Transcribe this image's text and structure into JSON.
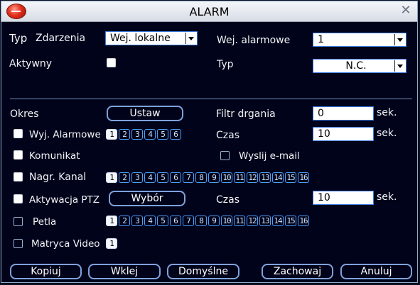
{
  "window": {
    "title": "ALARM"
  },
  "row_typ": {
    "label_typ": "Typ",
    "label_zdarzenia": "Zdarzenia",
    "value": "Wej. lokalne"
  },
  "row_wej": {
    "label": "Wej. alarmowe",
    "value": "1"
  },
  "row_aktywny": {
    "label": "Aktywny",
    "checked": false
  },
  "row_typ2": {
    "label": "Typ",
    "value": "N.C."
  },
  "okres": {
    "label": "Okres",
    "button": "Ustaw"
  },
  "filtr": {
    "label": "Filtr drgania",
    "value": "0",
    "unit": "sek."
  },
  "wyj": {
    "label": "Wyj. Alarmowe",
    "checked": false,
    "channels": [
      "1",
      "2",
      "3",
      "4",
      "5",
      "6"
    ],
    "selected": [
      "1"
    ]
  },
  "czas1": {
    "label": "Czas",
    "value": "10",
    "unit": "sek."
  },
  "komunikat": {
    "label": "Komunikat",
    "checked": true
  },
  "email": {
    "label": "Wyslij e-mail",
    "checked": false
  },
  "nagr": {
    "label": "Nagr. Kanal",
    "checked": true,
    "channels": [
      "1",
      "2",
      "3",
      "4",
      "5",
      "6",
      "7",
      "8",
      "9",
      "10",
      "11",
      "12",
      "13",
      "14",
      "15",
      "16"
    ],
    "selected": [
      "1"
    ]
  },
  "ptz": {
    "label": "Aktywacja PTZ",
    "checked": true,
    "button": "Wybór"
  },
  "czas2": {
    "label": "Czas",
    "value": "10",
    "unit": "sek."
  },
  "petla": {
    "label": "Petla",
    "checked": false,
    "channels": [
      "1",
      "2",
      "3",
      "4",
      "5",
      "6",
      "7",
      "8",
      "9",
      "10",
      "11",
      "12",
      "13",
      "14",
      "15",
      "16"
    ],
    "selected": [
      "1"
    ]
  },
  "matryca": {
    "label": "Matryca Video",
    "checked": false,
    "channels": [
      "1"
    ],
    "selected": [
      "1"
    ]
  },
  "buttons": {
    "kopiuj": "Kopiuj",
    "wklej": "Wklej",
    "domyslne": "Domyślne",
    "zachowaj": "Zachowaj",
    "anuluj": "Anuluj"
  },
  "colors": {
    "background": "#01031a",
    "accent": "#4aa0ff",
    "border": "#7ea2dc"
  }
}
